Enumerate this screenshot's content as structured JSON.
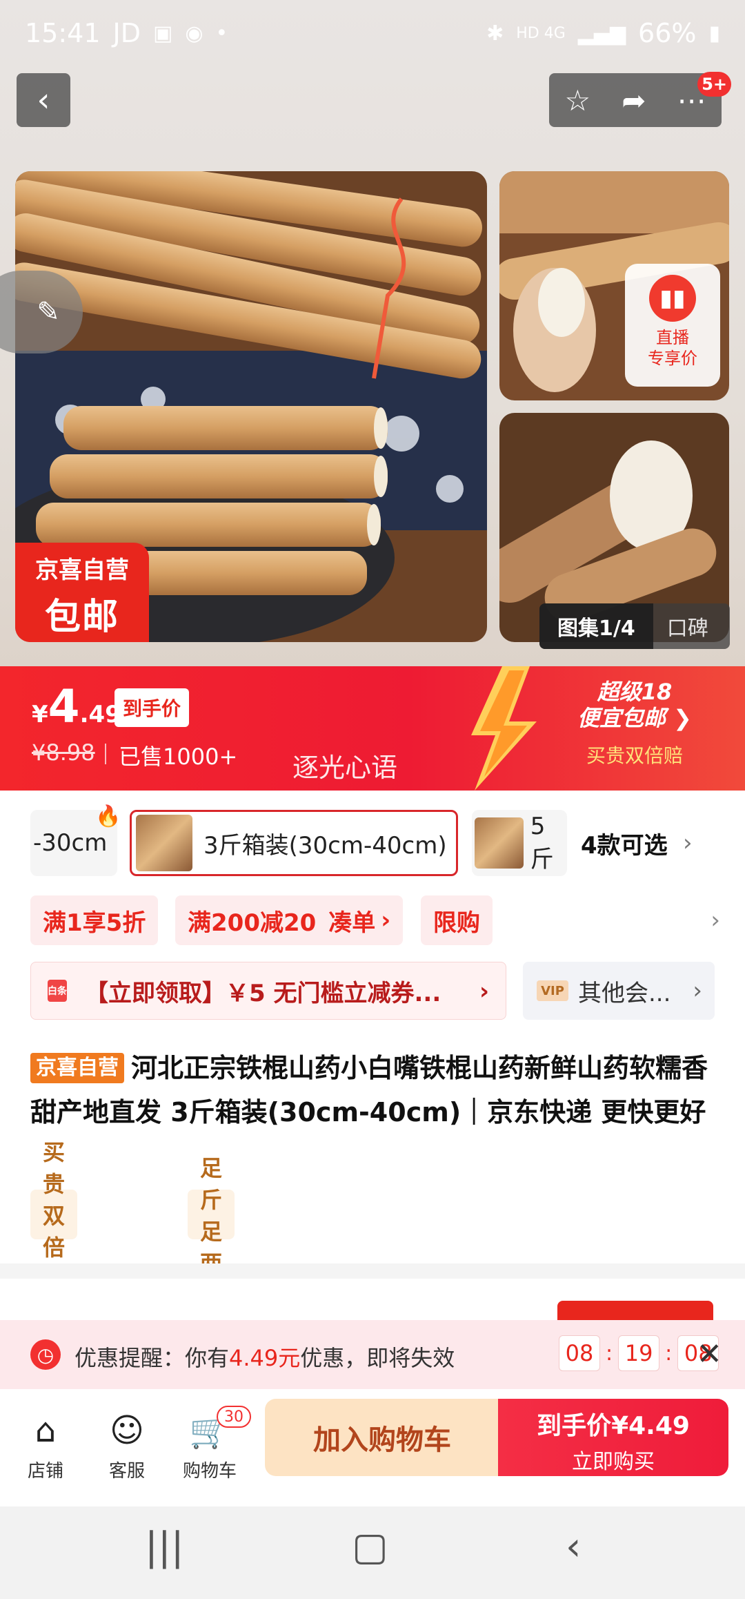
{
  "status_bar": {
    "time": "15:41",
    "carrier": "JD",
    "right_text": "HD 4G",
    "battery": "66%"
  },
  "top_bar": {
    "notification_badge": "5+"
  },
  "gallery": {
    "promo_tag_line1": "京喜自营",
    "promo_tag_line2": "包邮",
    "live_label_line1": "直播",
    "live_label_line2": "专享价",
    "active_tab": "图集1/4",
    "other_tab": "口碑"
  },
  "price_banner": {
    "currency": "¥",
    "price_int": "4",
    "price_dec": ".49",
    "final_price_tag": "到手价",
    "original_price": "¥8.98",
    "sold": "已售1000+",
    "watermark": "逐光心语",
    "super_line1": "超级18",
    "super_line2": "便宜包邮",
    "guarantee": "买贵双倍赔"
  },
  "sku": {
    "first": "-30cm",
    "selected": "3斤箱装(30cm-40cm)",
    "third": "5斤",
    "count": "4款可选"
  },
  "promotions": [
    "满1享5折",
    "满200减20",
    "凑单",
    "限购"
  ],
  "coupon": {
    "icon_label": "白条",
    "text": "【立即领取】￥5 无门槛立减券...",
    "vip_label": "VIP",
    "vip_text": "其他会..."
  },
  "product": {
    "store_tag": "京喜自营",
    "title": "河北正宗铁棍山药小白嘴铁棍山药新鲜山药软糯香甜产地直发 3斤箱装(30cm-40cm)｜京东快递 更快更好"
  },
  "features": [
    "买贵双倍赔",
    "足斤足两"
  ],
  "reminder": {
    "prefix": "优惠提醒：你有",
    "amount": "4.49元",
    "suffix": "优惠，即将失效",
    "timer": [
      "08",
      "19",
      "08"
    ]
  },
  "bottom_bar": {
    "store": "店铺",
    "service": "客服",
    "cart": "购物车",
    "cart_count": "30",
    "add_to_cart": "加入购物车",
    "buy_price": "到手价¥4.49",
    "buy_now": "立即购买"
  },
  "colors": {
    "brand_red": "#e8261d",
    "cart_bg": "#fde3c3"
  }
}
